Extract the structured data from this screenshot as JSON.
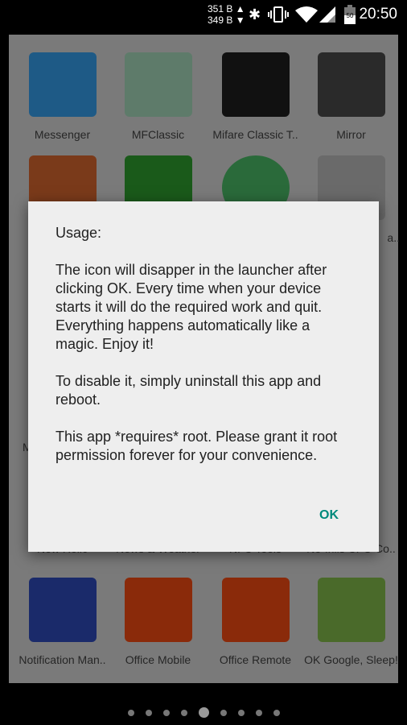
{
  "status_bar": {
    "net_up": "351 B ▲",
    "net_down": "349 B ▼",
    "battery_level": "50",
    "time": "20:50"
  },
  "apps": [
    {
      "label": "Messenger",
      "color": "#1e5a86"
    },
    {
      "label": "MFClassic",
      "color": "#5e7b6a"
    },
    {
      "label": "Mifare Classic T..",
      "color": "#111111"
    },
    {
      "label": "Mirror",
      "color": "#2a2a2a"
    },
    {
      "label": "",
      "color": "#7a3a1a"
    },
    {
      "label": "",
      "color": "#1a5a1a"
    },
    {
      "label": "",
      "color": "#2a6a3a"
    },
    {
      "label": "a..",
      "color": "#6a6a6a"
    },
    {
      "label": "New Relic"
    },
    {
      "label": "News & Weather"
    },
    {
      "label": "NFC Tools"
    },
    {
      "label": "No-frills CPU Co.."
    },
    {
      "label": "Notification Man..",
      "color": "#1a2a6a"
    },
    {
      "label": "Office Mobile",
      "color": "#8a2a0a"
    },
    {
      "label": "Office Remote",
      "color": "#8a2a0a"
    },
    {
      "label": "OK Google, Sleep!",
      "color": "#4a6a2a"
    }
  ],
  "partial_left_label": "M",
  "dialog": {
    "title": "Usage:",
    "paragraph1": "The icon will disapper in the launcher after clicking OK. Every time when your device starts it will do the required work and quit. Everything happens automatically like a magic. Enjoy it!",
    "paragraph2": "To disable it, simply uninstall this app and reboot.",
    "paragraph3": "This app *requires* root. Please grant it root permission forever for your convenience.",
    "ok_label": "OK"
  },
  "page_indicator": {
    "pages": 9,
    "current": 5
  }
}
